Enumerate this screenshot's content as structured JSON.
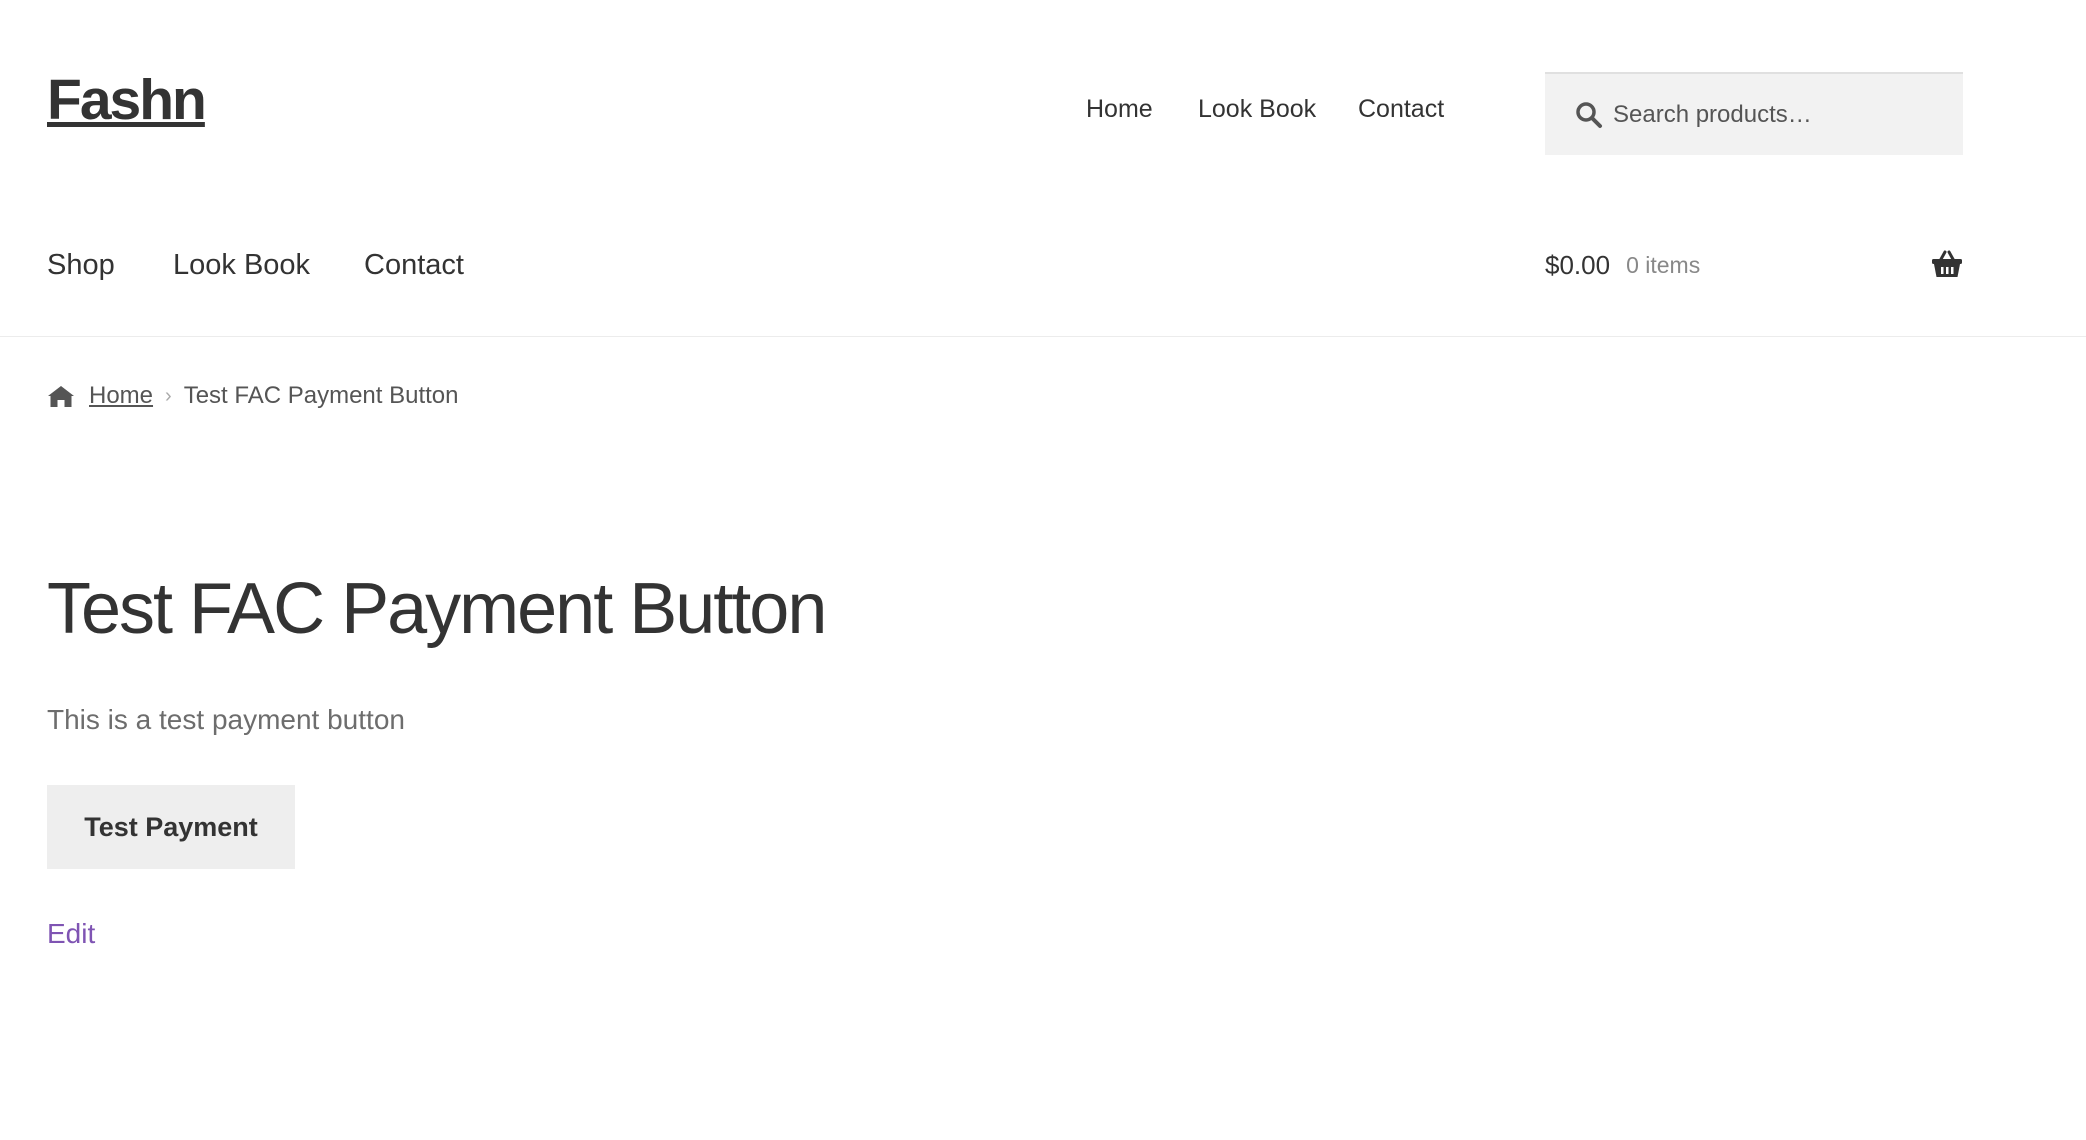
{
  "site": {
    "title": "Fashn"
  },
  "secondary_nav": {
    "items": [
      "Home",
      "Look Book",
      "Contact"
    ]
  },
  "search": {
    "placeholder": "Search products…",
    "icon": "search-icon"
  },
  "primary_nav": {
    "items": [
      "Shop",
      "Look Book",
      "Contact"
    ]
  },
  "cart": {
    "amount": "$0.00",
    "count": "0 items",
    "icon": "basket-icon"
  },
  "breadcrumb": {
    "home": "Home",
    "current": "Test FAC Payment Button",
    "separator": "›"
  },
  "page": {
    "title": "Test FAC Payment Button",
    "description": "This is a test payment button",
    "button_label": "Test Payment",
    "edit_label": "Edit"
  },
  "colors": {
    "text": "#333333",
    "muted": "#6d6d6d",
    "link_accent": "#7f54b3",
    "button_bg": "#eeeeee",
    "search_bg": "#f2f2f2"
  }
}
